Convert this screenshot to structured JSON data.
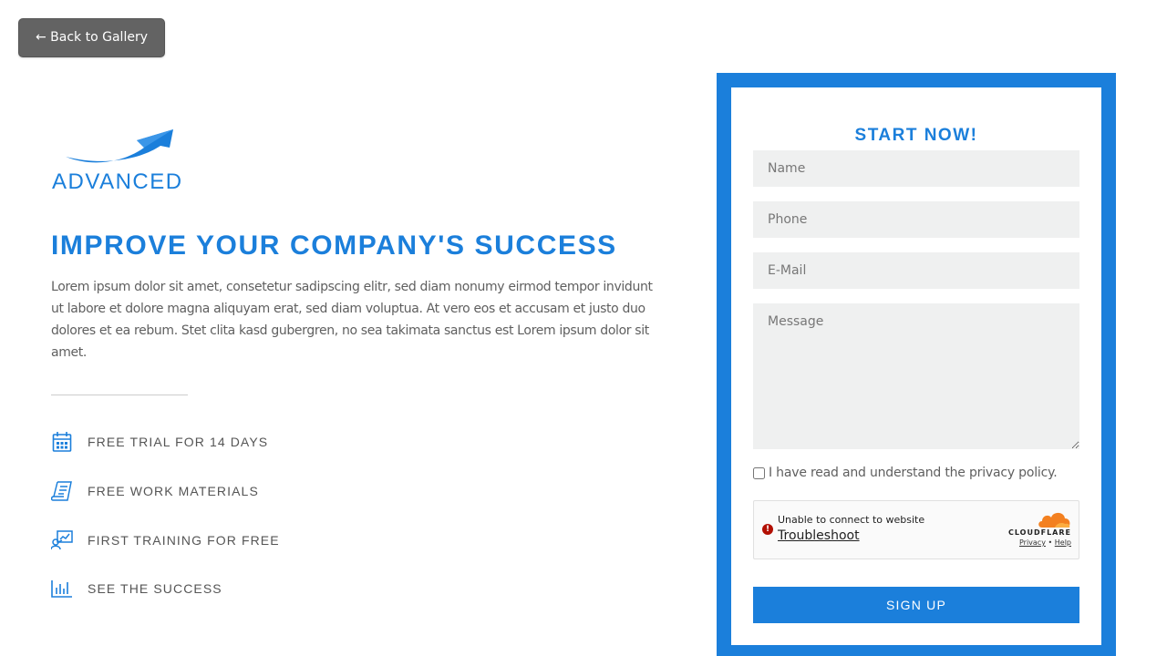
{
  "nav": {
    "back_label": "← Back to Gallery"
  },
  "brand": {
    "logo_text": "ADVANCED",
    "accent_color": "#1b7fdb"
  },
  "hero": {
    "headline": "IMPROVE YOUR COMPANY'S SUCCESS",
    "intro": "Lorem ipsum dolor sit amet, consetetur sadipscing elitr, sed diam nonumy eirmod tempor invidunt ut labore et dolore magna aliquyam erat, sed diam voluptua. At vero eos et accusam et justo duo dolores et ea rebum. Stet clita kasd gubergren, no sea takimata sanctus est Lorem ipsum dolor sit amet."
  },
  "features": [
    {
      "icon": "calendar-icon",
      "label": "FREE TRIAL FOR 14 DAYS"
    },
    {
      "icon": "document-icon",
      "label": "FREE WORK MATERIALS"
    },
    {
      "icon": "training-icon",
      "label": "FIRST TRAINING FOR FREE"
    },
    {
      "icon": "bar-chart-icon",
      "label": "SEE THE SUCCESS"
    }
  ],
  "form": {
    "title": "START NOW!",
    "name_placeholder": "Name",
    "phone_placeholder": "Phone",
    "email_placeholder": "E-Mail",
    "message_placeholder": "Message",
    "consent_label": "I have read and understand the privacy policy.",
    "consent_checked": false,
    "submit_label": "SIGN UP"
  },
  "captcha": {
    "message": "Unable to connect to website",
    "link": "Troubleshoot",
    "brand": "CLOUDFLARE",
    "privacy": "Privacy",
    "separator": "•",
    "help": "Help",
    "error_icon": "!"
  }
}
